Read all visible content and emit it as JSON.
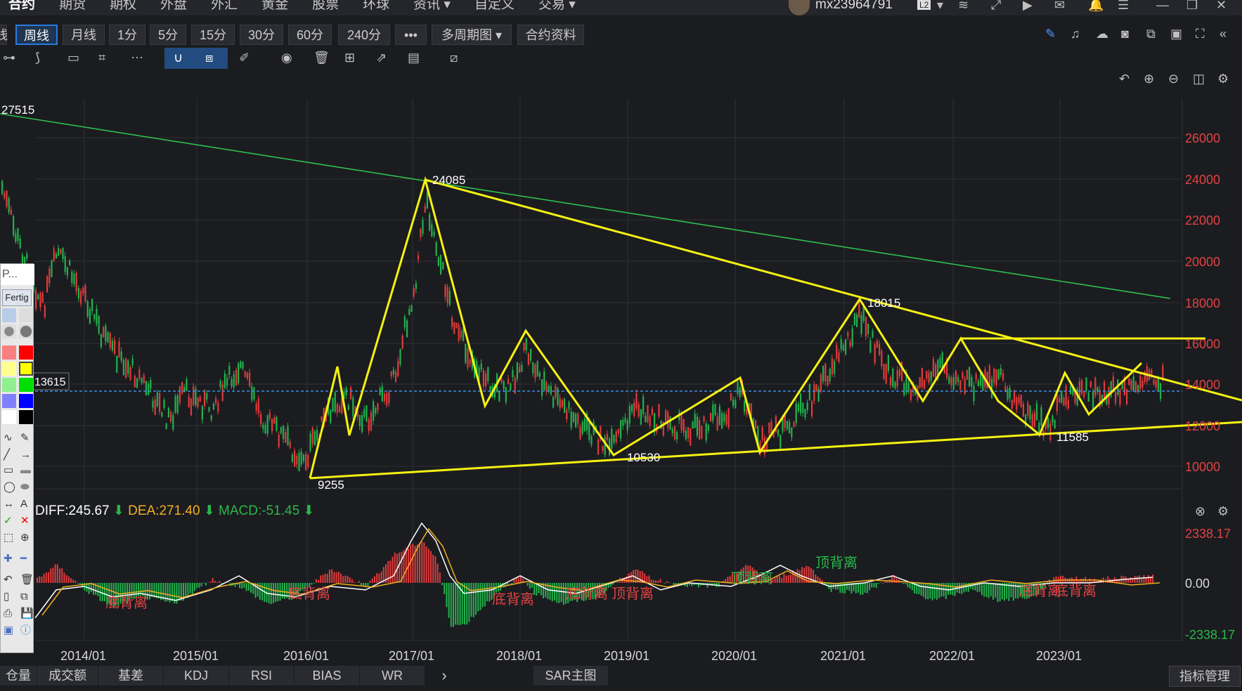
{
  "nav": {
    "items": [
      "合约",
      "期货",
      "期权",
      "外盘",
      "外汇",
      "黄金",
      "股票",
      "环球",
      "资讯 ▾",
      "自定义",
      "交易 ▾"
    ],
    "user": "mx23964791",
    "user_badge": "L2"
  },
  "periods": {
    "items": [
      "周线",
      "月线",
      "1分",
      "5分",
      "15分",
      "30分",
      "60分",
      "240分",
      "•••",
      "多周期图 ▾",
      "合约资料"
    ],
    "active": "周线"
  },
  "price_axis": {
    "ticks": [
      "26000",
      "24000",
      "22000",
      "20000",
      "18000",
      "16000",
      "14000",
      "12000",
      "10000"
    ]
  },
  "time_axis": {
    "ticks": [
      "2014/01",
      "2015/01",
      "2016/01",
      "2017/01",
      "2018/01",
      "2019/01",
      "2020/01",
      "2021/01",
      "2022/01",
      "2023/01"
    ]
  },
  "annotations": {
    "high_left": "27515",
    "peak_2017": "24085",
    "peak_2021": "18015",
    "low_2016": "9255",
    "low_2019": "10530",
    "low_2022": "11585",
    "current_price": "13615"
  },
  "macd": {
    "diff": "DIFF:245.67",
    "dea": "DEA:271.40",
    "macd": "MACD:-51.45",
    "upper": "2338.17",
    "zero": "0.00",
    "lower": "-2338.17",
    "signals": [
      {
        "text": "底背离",
        "color": "#e04343",
        "xi": 0
      },
      {
        "text": "底背离",
        "color": "#e04343",
        "xi": 1
      },
      {
        "text": "底背离",
        "color": "#e04343",
        "xi": 2
      },
      {
        "text": "底背离",
        "color": "#e04343",
        "xi": 3
      },
      {
        "text": "顶背离",
        "color": "#e04343",
        "xi": 4
      },
      {
        "text": "顶背离",
        "color": "#28b84a",
        "xi": 5
      },
      {
        "text": "顶背离",
        "color": "#28b84a",
        "xi": 6
      },
      {
        "text": "底背离",
        "color": "#e04343",
        "xi": 7
      },
      {
        "text": "底背离",
        "color": "#e04343",
        "xi": 8
      }
    ]
  },
  "bottom_tabs": [
    "仓量",
    "成交额",
    "基差",
    "KDJ",
    "RSI",
    "BIAS",
    "WR",
    "›",
    "SAR主图"
  ],
  "index_manage": "指标管理",
  "palette": {
    "title": "P...",
    "button": "Fertig"
  },
  "colors": {
    "up": "#e03b3b",
    "down": "#22b14c",
    "trend": "#f5f211",
    "longline": "#2dbf4f",
    "dashed": "#3a8fe8",
    "bg": "#1b1c20"
  },
  "icons": [
    "undo-icon",
    "zoom-in-icon",
    "zoom-out-icon",
    "layout-icon",
    "settings-icon",
    "close-icon",
    "pencil-icon",
    "bell-icon",
    "cloud-icon",
    "camera-icon",
    "copy-icon",
    "monitor-icon",
    "fullscreen-icon",
    "collapse-icon"
  ]
}
